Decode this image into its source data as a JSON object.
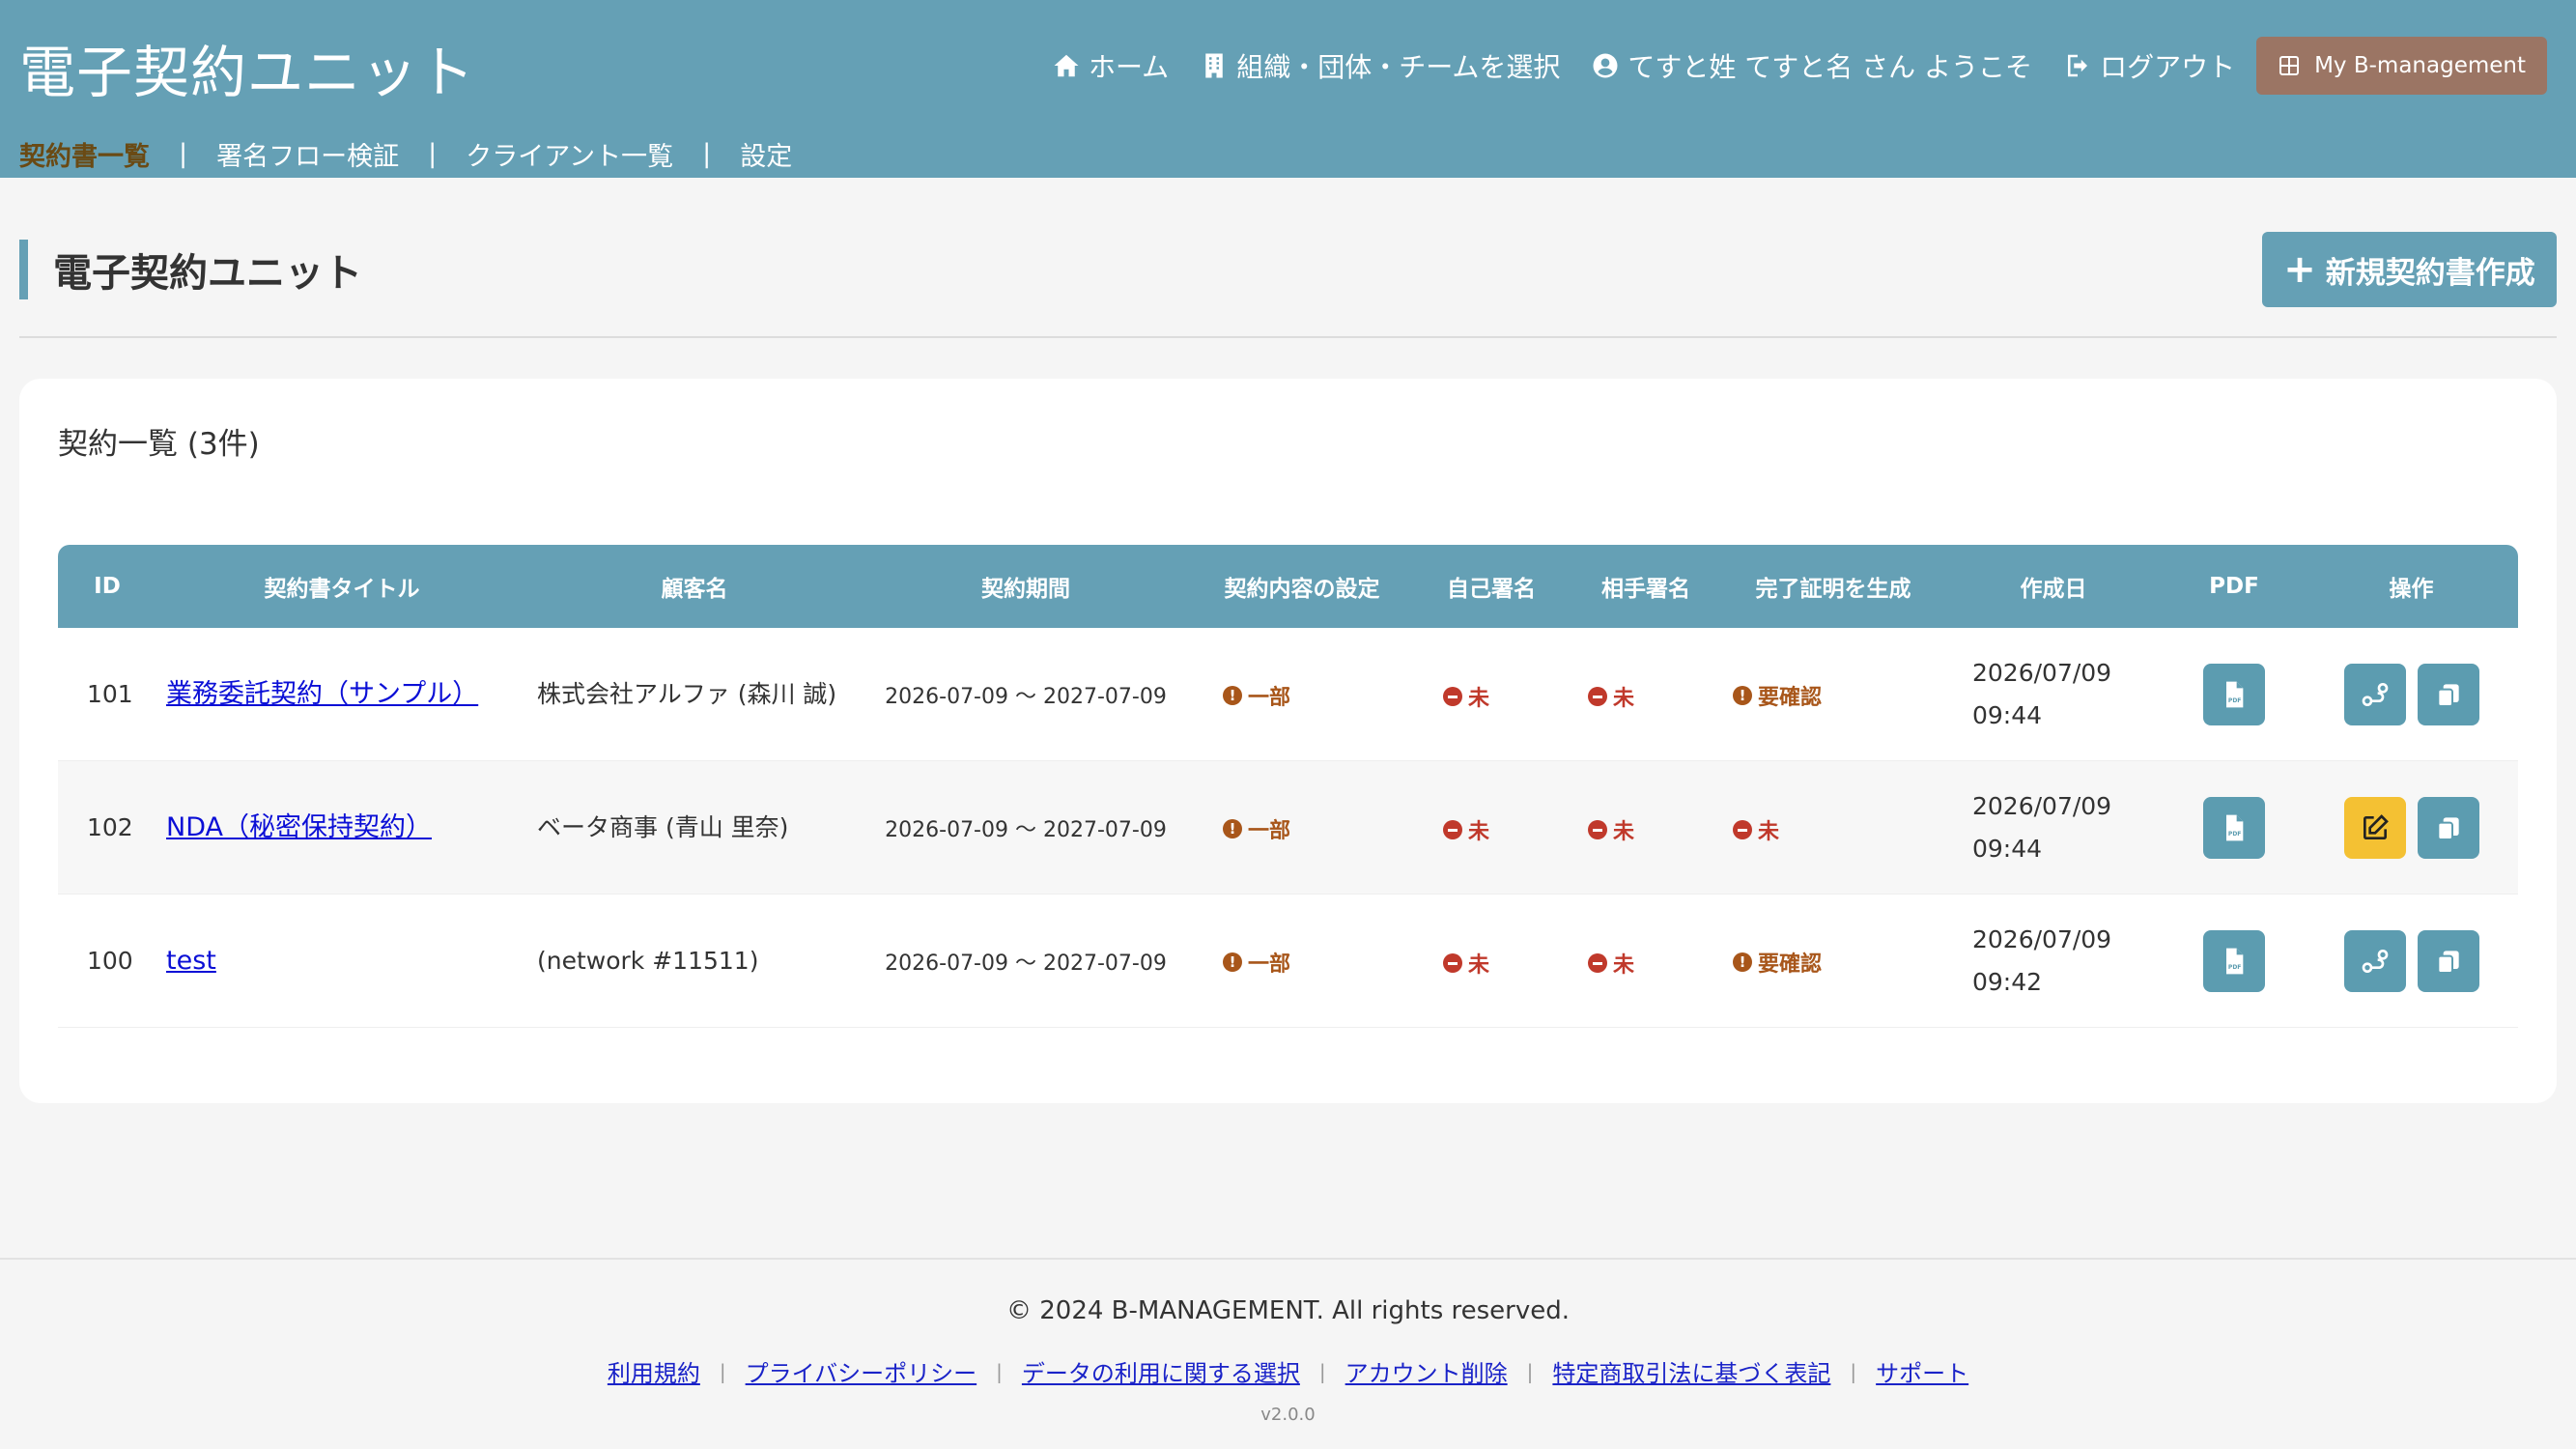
{
  "header": {
    "brand": "電子契約ユニット",
    "nav": {
      "home": "ホーム",
      "select_org": "組織・団体・チームを選択",
      "welcome": "てすと姓 てすと名 さん ようこそ",
      "logout": "ログアウト",
      "my_bm": "My B-management"
    },
    "subnav": [
      "契約書一覧",
      "署名フロー検証",
      "クライアント一覧",
      "設定"
    ],
    "subnav_separator": "|"
  },
  "page": {
    "title": "電子契約ユニット",
    "new_button_plus": "+",
    "new_button": "新規契約書作成"
  },
  "card": {
    "title": "契約一覧 (3件)"
  },
  "table": {
    "headers": {
      "id": "ID",
      "title": "契約書タイトル",
      "client": "顧客名",
      "period": "契約期間",
      "setting": "契約内容の設定",
      "self": "自己署名",
      "peer": "相手署名",
      "proof": "完了証明を生成",
      "created": "作成日",
      "pdf": "PDF",
      "ops": "操作"
    },
    "rows": [
      {
        "id": "101",
        "title": "業務委託契約（サンプル）",
        "client": "株式会社アルファ (森川 誠)",
        "period": "2026-07-09 〜 2027-07-09",
        "setting": "一部",
        "self": "未",
        "peer": "未",
        "proof": "要確認",
        "created_date": "2026/07/09",
        "created_time": "09:44"
      },
      {
        "id": "102",
        "title": "NDA（秘密保持契約）",
        "client": "ベータ商事 (青山 里奈)",
        "period": "2026-07-09 〜 2027-07-09",
        "setting": "一部",
        "self": "未",
        "peer": "未",
        "proof": "未",
        "created_date": "2026/07/09",
        "created_time": "09:44"
      },
      {
        "id": "100",
        "title": "test",
        "client": "(network #11511)",
        "period": "2026-07-09 〜 2027-07-09",
        "setting": "一部",
        "self": "未",
        "peer": "未",
        "proof": "要確認",
        "created_date": "2026/07/09",
        "created_time": "09:42"
      }
    ]
  },
  "footer": {
    "copyright": "© 2024 B-MANAGEMENT. All rights reserved.",
    "links": [
      "利用規約",
      "プライバシーポリシー",
      "データの利用に関する選択",
      "アカウント削除",
      "特定商取引法に基づく表記",
      "サポート"
    ],
    "separator": "|",
    "version": "v2.0.0"
  },
  "colors": {
    "header": "#65a0b5",
    "accent_brown": "#9b7564",
    "warn": "#a8561a",
    "danger": "#c0392b",
    "edit": "#f4c133"
  },
  "icons": {
    "home": "home-icon",
    "org": "building-icon",
    "user": "user-circle-icon",
    "logout": "logout-icon",
    "grid": "grid-icon",
    "pdf": "pdf-file-icon",
    "flow": "signature-flow-icon",
    "edit": "edit-icon",
    "copy": "copy-icon"
  }
}
